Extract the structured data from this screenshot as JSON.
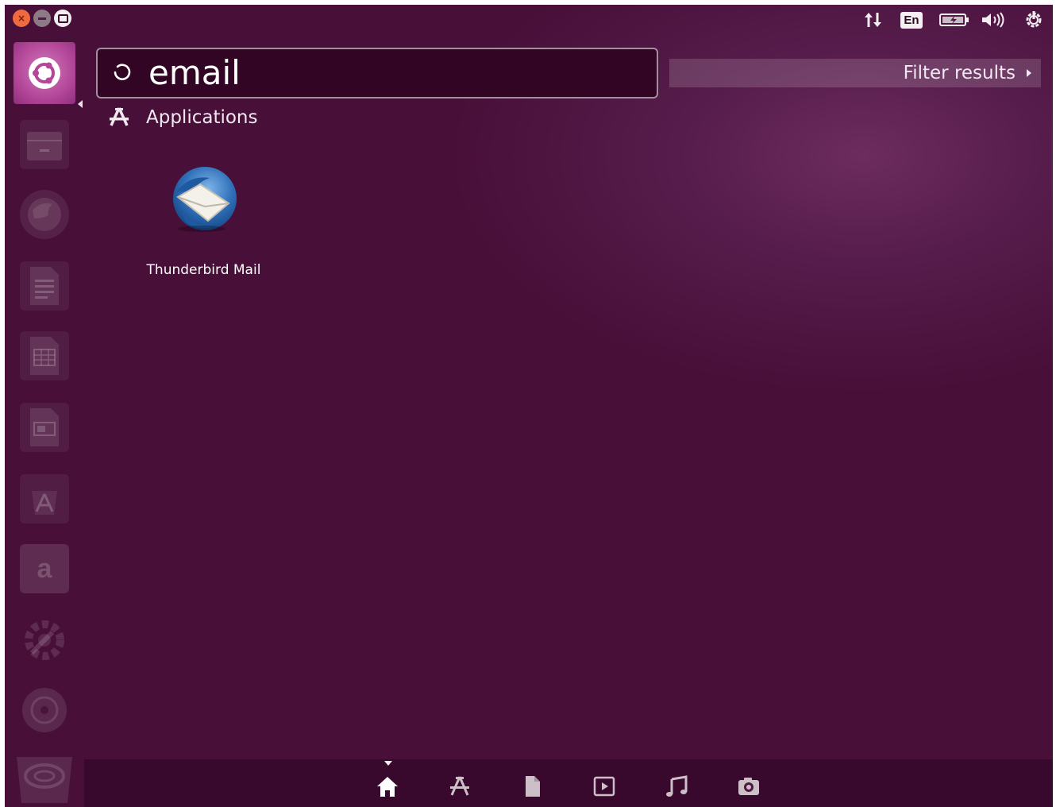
{
  "top_bar": {
    "window_buttons": [
      "close-icon",
      "minimize-icon",
      "maximize-icon"
    ],
    "indicators": {
      "network": "network-updown-icon",
      "keyboard_layout": "En",
      "battery": "battery-icon",
      "volume": "volume-icon",
      "power": "power-gear-icon"
    }
  },
  "launcher": {
    "items": [
      {
        "name": "dash-home",
        "icon": "ubuntu-logo-icon"
      },
      {
        "name": "files",
        "icon": "file-cabinet-icon"
      },
      {
        "name": "firefox",
        "icon": "firefox-icon"
      },
      {
        "name": "writer",
        "icon": "document-icon"
      },
      {
        "name": "calc",
        "icon": "spreadsheet-icon"
      },
      {
        "name": "impress",
        "icon": "presentation-icon"
      },
      {
        "name": "software-center",
        "icon": "software-center-icon"
      },
      {
        "name": "amazon",
        "icon": "amazon-icon",
        "glyph": "a"
      },
      {
        "name": "system-settings",
        "icon": "settings-gear-icon"
      },
      {
        "name": "disc",
        "icon": "disc-icon"
      },
      {
        "name": "trash",
        "icon": "trash-icon"
      }
    ]
  },
  "search": {
    "query": "email"
  },
  "filter": {
    "label": "Filter results"
  },
  "results": {
    "category": "Applications",
    "items": [
      {
        "label": "Thunderbird Mail",
        "icon": "thunderbird-icon"
      }
    ]
  },
  "lenses": [
    "home-lens-icon",
    "applications-lens-icon",
    "files-lens-icon",
    "video-lens-icon",
    "music-lens-icon",
    "photo-lens-icon"
  ],
  "colors": {
    "background": "#480f39",
    "search_box": "#330525",
    "home_tile": "#b4479a"
  }
}
